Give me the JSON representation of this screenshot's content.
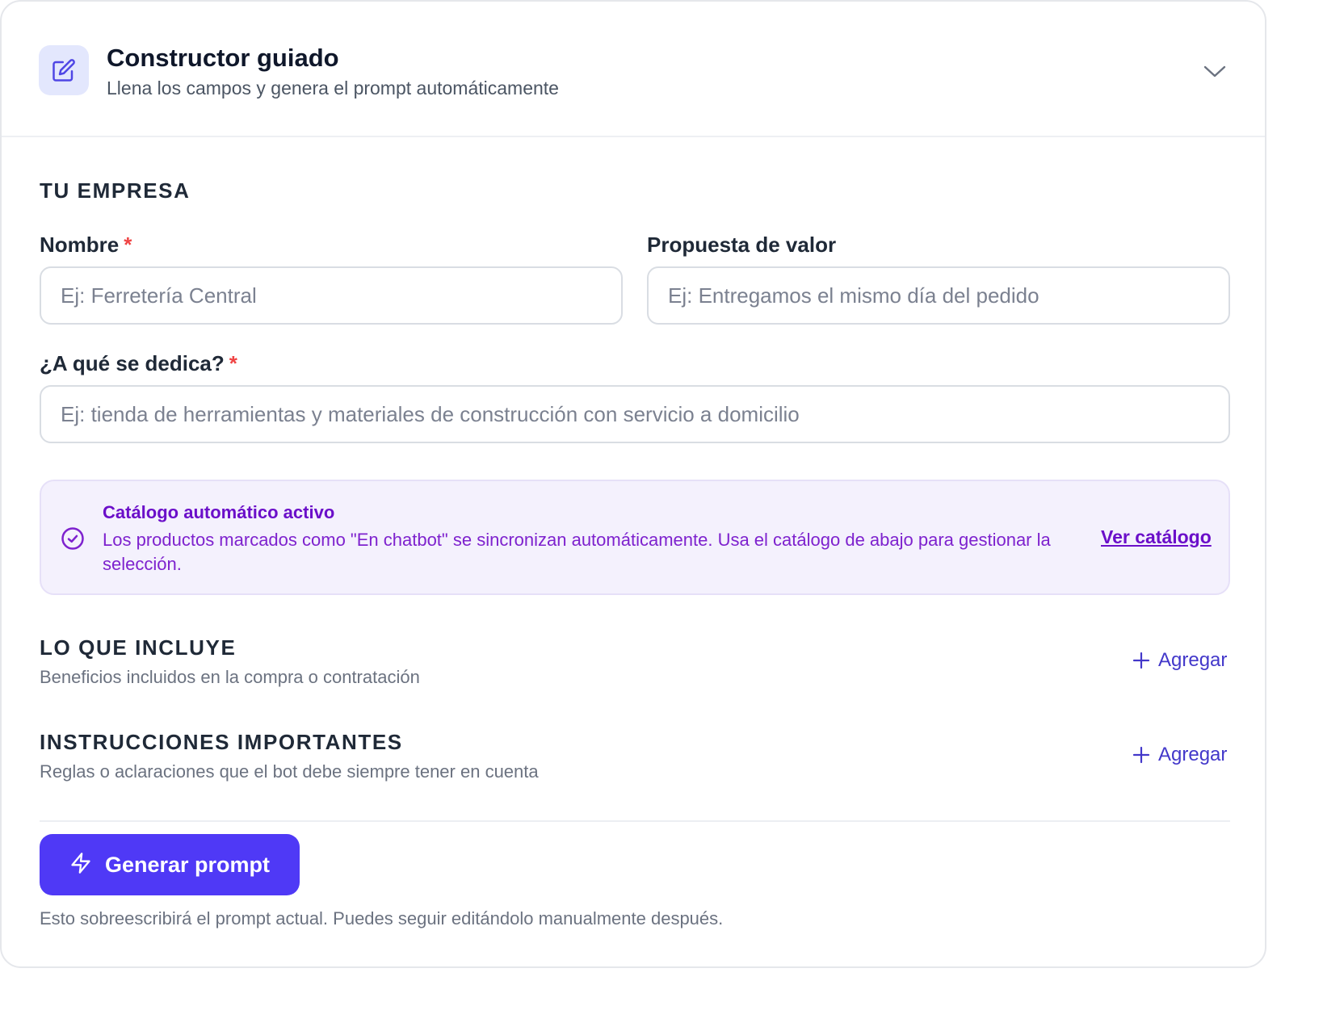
{
  "header": {
    "title": "Constructor guiado",
    "subtitle": "Llena los campos y genera el prompt automáticamente"
  },
  "company": {
    "section_title": "TU EMPRESA",
    "name_label": "Nombre",
    "name_required": "*",
    "name_placeholder": "Ej: Ferretería Central",
    "value_prop_label": "Propuesta de valor",
    "value_prop_placeholder": "Ej: Entregamos el mismo día del pedido",
    "activity_label": "¿A qué se dedica?",
    "activity_required": "*",
    "activity_placeholder": "Ej: tienda de herramientas y materiales de construcción con servicio a domicilio"
  },
  "catalog_notice": {
    "title": "Catálogo automático activo",
    "text": "Los productos marcados como \"En chatbot\" se sincronizan automáticamente. Usa el catálogo de abajo para gestionar la selección.",
    "link": "Ver catálogo"
  },
  "includes": {
    "title": "LO QUE INCLUYE",
    "subtitle": "Beneficios incluidos en la compra o contratación",
    "add_label": "Agregar"
  },
  "instructions": {
    "title": "INSTRUCCIONES IMPORTANTES",
    "subtitle": "Reglas o aclaraciones que el bot debe siempre tener en cuenta",
    "add_label": "Agregar"
  },
  "generate": {
    "button_label": "Generar prompt",
    "note": "Esto sobreescribirá el prompt actual. Puedes seguir editándolo manualmente después."
  },
  "colors": {
    "accent": "#4f39f6",
    "purple_text": "#7e22ce",
    "required": "#ef4444"
  }
}
